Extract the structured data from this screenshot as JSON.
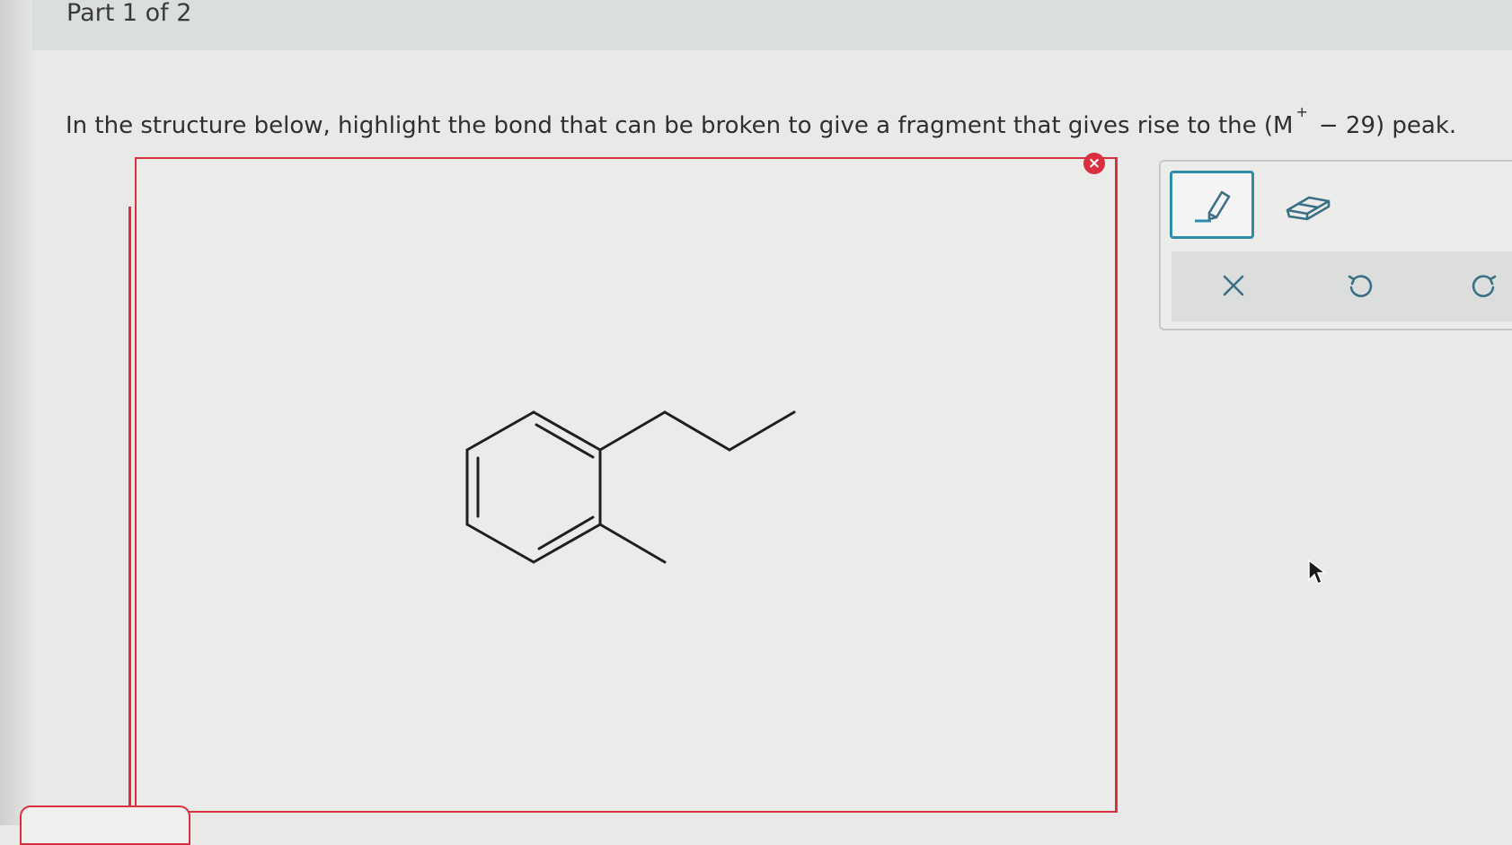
{
  "header": {
    "part_label": "Part 1 of 2"
  },
  "question": {
    "text_before": "In the structure below, highlight the bond that can be broken to give a fragment that gives rise to the (M",
    "superscript": "+",
    "text_after": "− 29) peak."
  },
  "canvas": {
    "status": "error",
    "error_badge": "×",
    "border_color": "#d9303f"
  },
  "toolbar": {
    "tools": [
      {
        "name": "highlighter",
        "icon": "pen-icon",
        "active": true
      },
      {
        "name": "eraser",
        "icon": "eraser-icon",
        "active": false
      }
    ],
    "actions": [
      {
        "name": "clear",
        "icon": "close-icon"
      },
      {
        "name": "undo",
        "icon": "undo-icon"
      },
      {
        "name": "redo",
        "icon": "redo-icon"
      }
    ],
    "accent_color": "#2f8ca8",
    "icon_color": "#3b6f86"
  }
}
